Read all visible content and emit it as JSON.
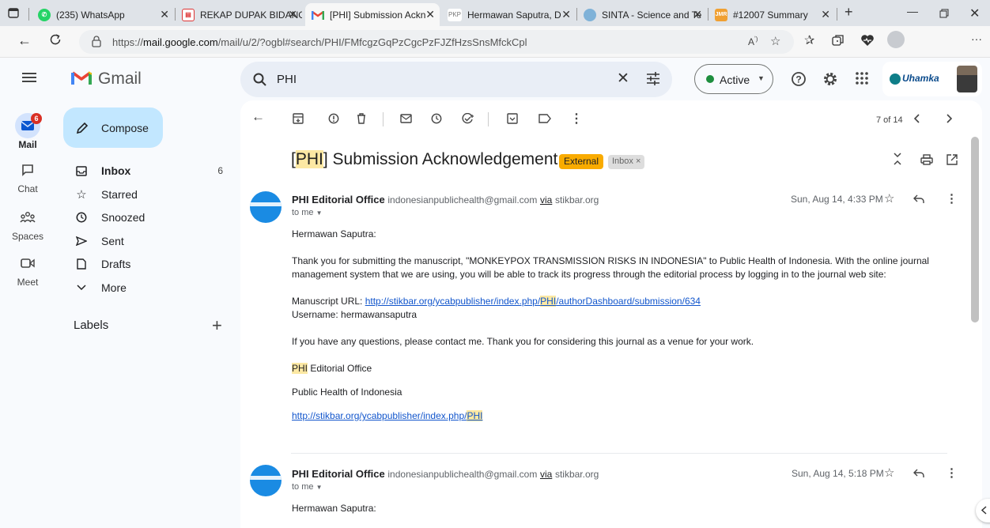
{
  "browser": {
    "tabs": [
      {
        "title": "(235) WhatsApp",
        "icon": "whatsapp-icon"
      },
      {
        "title": "REKAP DUPAK BIDANG",
        "icon": "pdf-icon"
      },
      {
        "title": "[PHI] Submission Ackn",
        "icon": "gmail-icon",
        "active": true
      },
      {
        "title": "Hermawan Saputra, D",
        "icon": "pkp-icon",
        "badge": "PKP"
      },
      {
        "title": "SINTA - Science and Te",
        "icon": "sinta-icon"
      },
      {
        "title": "#12007 Summary",
        "icon": "journal-icon",
        "badge": "JMR"
      }
    ],
    "url_prefix": "https://",
    "url_domain": "mail.google.com",
    "url_rest": "/mail/u/2/?ogbl#search/PHI/FMfcgzGqPzCgcPzFJZfHzsSnsMfckCpl"
  },
  "gmail": {
    "logo_text": "Gmail",
    "search_value": "PHI",
    "status_label": "Active",
    "org_logo_text": "Uhamka",
    "rail": [
      {
        "label": "Mail",
        "badge": "6"
      },
      {
        "label": "Chat"
      },
      {
        "label": "Spaces"
      },
      {
        "label": "Meet"
      }
    ],
    "compose_label": "Compose",
    "nav": [
      {
        "label": "Inbox",
        "count": "6"
      },
      {
        "label": "Starred",
        "count": ""
      },
      {
        "label": "Snoozed",
        "count": ""
      },
      {
        "label": "Sent",
        "count": ""
      },
      {
        "label": "Drafts",
        "count": ""
      },
      {
        "label": "More",
        "count": ""
      }
    ],
    "labels_heading": "Labels",
    "pagination": "7 of 14"
  },
  "thread": {
    "subject_tag": "PHI",
    "subject_rest": " Submission Acknowledgement",
    "external_badge": "External",
    "inbox_chip": "Inbox",
    "messages": [
      {
        "sender_name": "PHI Editorial Office",
        "sender_email": "indonesianpublichealth@gmail.com",
        "via_word": "via",
        "via_domain": "stikbar.org",
        "recipient": "to me",
        "date": "Sun, Aug 14, 4:33 PM",
        "greeting": "Hermawan Saputra:",
        "paragraph1": "Thank you for submitting the manuscript, \"MONKEYPOX TRANSMISSION RISKS IN INDONESIA\" to Public Health of Indonesia. With the online journal management system that we are using, you will be able to track its progress through the editorial process by logging in to the journal web site:",
        "manuscript_url_label": "Manuscript URL: ",
        "manuscript_url_a": "http://stikbar.org/ycabpublisher/index.php/",
        "manuscript_url_hl": "PHI",
        "manuscript_url_b": "/authorDashboard/submission/634",
        "username_line": "Username: hermawansaputra",
        "paragraph2": "If you have any questions, please contact me. Thank you for considering this journal as a venue for your work.",
        "sig_hl": "PHI",
        "sig_rest": " Editorial Office",
        "sig_org": "Public Health of Indonesia",
        "sig_link_a": "http://stikbar.org/ycabpublisher/index.php/",
        "sig_link_hl": "PHI"
      },
      {
        "sender_name": "PHI Editorial Office",
        "sender_email": "indonesianpublichealth@gmail.com",
        "via_word": "via",
        "via_domain": "stikbar.org",
        "recipient": "to me",
        "date": "Sun, Aug 14, 5:18 PM",
        "greeting": "Hermawan Saputra:"
      }
    ]
  },
  "colors": {
    "accent": "#c2e7ff",
    "badge_red": "#d93025",
    "external_badge": "#f9ab00",
    "active_green": "#1e8e3e",
    "link": "#1155cc",
    "highlight": "#fce8a3"
  }
}
